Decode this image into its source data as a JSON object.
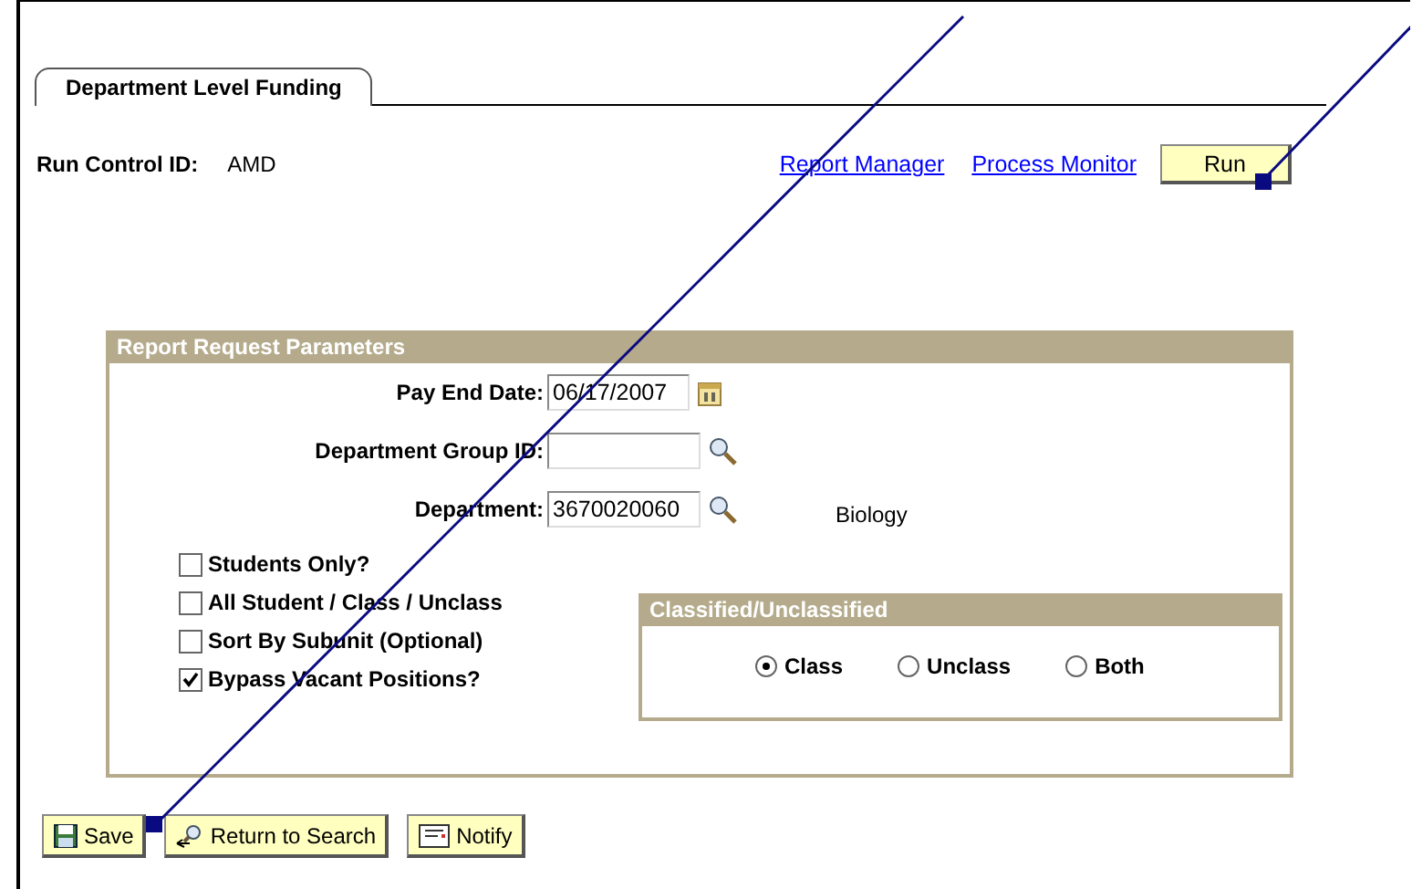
{
  "tab": {
    "label": "Department Level Funding",
    "selected": true
  },
  "run_control": {
    "label": "Run Control ID:",
    "value": "AMD"
  },
  "links": [
    "Report Manager",
    "Process Monitor"
  ],
  "run_button": "Run",
  "parameters": {
    "title": "Report Request Parameters",
    "fields": [
      {
        "label": "Pay End Date:",
        "value": "06/17/2007",
        "kind": "date"
      },
      {
        "label": "Department Group ID:",
        "kind": "lookup"
      },
      {
        "label": "Department:",
        "value": "3670020060",
        "kind": "lookup",
        "description": "Biology"
      }
    ],
    "checkboxes": [
      {
        "label": "Students Only?",
        "checked": false
      },
      {
        "label": "All Student / Class / Unclass",
        "checked": false
      },
      {
        "label": "Sort By Subunit (Optional)",
        "checked": false
      },
      {
        "label": "Bypass Vacant Positions?",
        "checked": true
      }
    ],
    "classified": {
      "title": "Classified/Unclassified",
      "options": [
        {
          "label": "Class",
          "selected": true
        },
        {
          "label": "Unclass",
          "selected": false
        },
        {
          "label": "Both",
          "selected": false
        }
      ]
    }
  },
  "buttons": [
    {
      "label": "Save",
      "kind": "save"
    },
    {
      "label": "Return to Search",
      "kind": "search"
    },
    {
      "label": "Notify",
      "kind": "notify"
    }
  ]
}
